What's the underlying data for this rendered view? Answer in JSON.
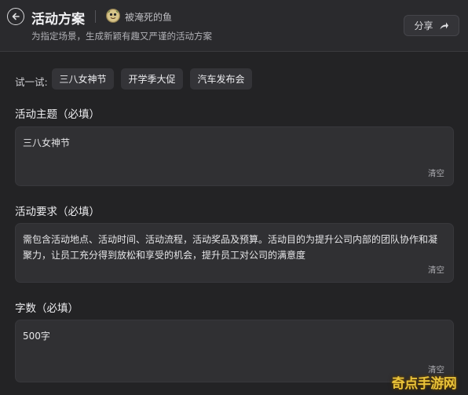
{
  "header": {
    "title": "活动方案",
    "author": "被淹死的鱼",
    "subtitle": "为指定场景，生成新颖有趣又严谨的活动方案",
    "share_label": "分享"
  },
  "try": {
    "label": "试一试:",
    "chips": [
      "三八女神节",
      "开学季大促",
      "汽车发布会"
    ]
  },
  "fields": [
    {
      "label": "活动主题（必填）",
      "value": "三八女神节",
      "clear": "清空"
    },
    {
      "label": "活动要求（必填）",
      "value": "需包含活动地点、活动时间、活动流程，活动奖品及预算。活动目的为提升公司内部的团队协作和凝聚力，让员工充分得到放松和享受的机会，提升员工对公司的满意度",
      "clear": "清空"
    },
    {
      "label": "字数（必填）",
      "value": "500字",
      "clear": "清空"
    }
  ],
  "watermark": "奇点手游网",
  "colors": {
    "background": "#232325",
    "header": "#2a2a2d",
    "input": "#303033",
    "chip": "#343438",
    "watermark": "#e8c23a"
  }
}
